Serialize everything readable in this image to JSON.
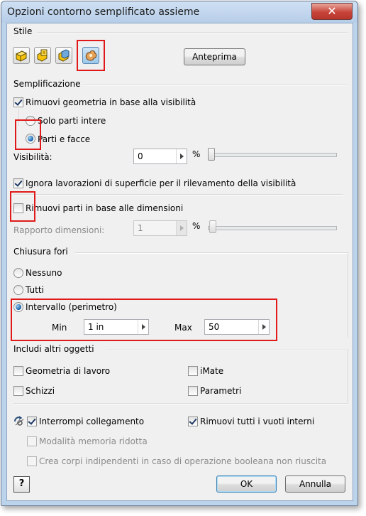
{
  "window": {
    "title": "Opzioni contorno semplificato assieme",
    "close_glyph": "✕"
  },
  "stile": {
    "label": "Stile",
    "icons": [
      "bounding-box-icon",
      "cylinder-box-icon",
      "outline-icon",
      "shrinkwrap-icon"
    ],
    "preview_button": "Anteprima"
  },
  "semplificazione": {
    "label": "Semplificazione",
    "remove_by_visibility": {
      "label": "Rimuovi geometria in base alla visibilità",
      "checked": true
    },
    "radio_whole_parts": {
      "label": "Solo parti intere",
      "selected": false
    },
    "radio_parts_faces": {
      "label": "Parti e facce",
      "selected": true
    },
    "visibility": {
      "label": "Visibilità:",
      "value": "0",
      "unit": "%",
      "slider_fraction": 0
    },
    "ignore_surface_features": {
      "label": "Ignora lavorazioni di superficie per il rilevamento della visibilità",
      "checked": true
    },
    "remove_by_size": {
      "label": "Rimuovi parti in base alle dimensioni",
      "checked": false
    },
    "size_ratio": {
      "label": "Rapporto dimensioni:",
      "value": "1",
      "unit": "%",
      "slider_fraction": 0
    }
  },
  "chiusura_fori": {
    "label": "Chiusura fori",
    "radio_none": {
      "label": "Nessuno",
      "selected": false
    },
    "radio_all": {
      "label": "Tutti",
      "selected": false
    },
    "radio_range": {
      "label": "Intervallo (perimetro)",
      "selected": true
    },
    "min": {
      "label": "Min",
      "value": "1 in"
    },
    "max": {
      "label": "Max",
      "value": "50"
    }
  },
  "includi": {
    "label": "Includi altri oggetti",
    "work_geometry": {
      "label": "Geometria di lavoro",
      "checked": false
    },
    "imate": {
      "label": "iMate",
      "checked": false
    },
    "sketches": {
      "label": "Schizzi",
      "checked": false
    },
    "parameters": {
      "label": "Parametri",
      "checked": false
    }
  },
  "bottom": {
    "break_link": {
      "label": "Interrompi collegamento",
      "checked": true,
      "icon": "break-link-icon"
    },
    "remove_voids": {
      "label": "Rimuovi tutti i vuoti interni",
      "checked": true
    },
    "reduced_memory": {
      "label": "Modalità memoria ridotta",
      "checked": false,
      "enabled": false
    },
    "independent_bodies": {
      "label": "Crea corpi indipendenti in caso di operazione booleana non riuscita",
      "checked": false,
      "enabled": false
    }
  },
  "footer": {
    "help_icon": "help-icon",
    "help_glyph": "?",
    "ok": "OK",
    "cancel": "Annulla"
  },
  "colors": {
    "highlight": "#e01a1a",
    "radio_selected": "#0f5aa8"
  }
}
